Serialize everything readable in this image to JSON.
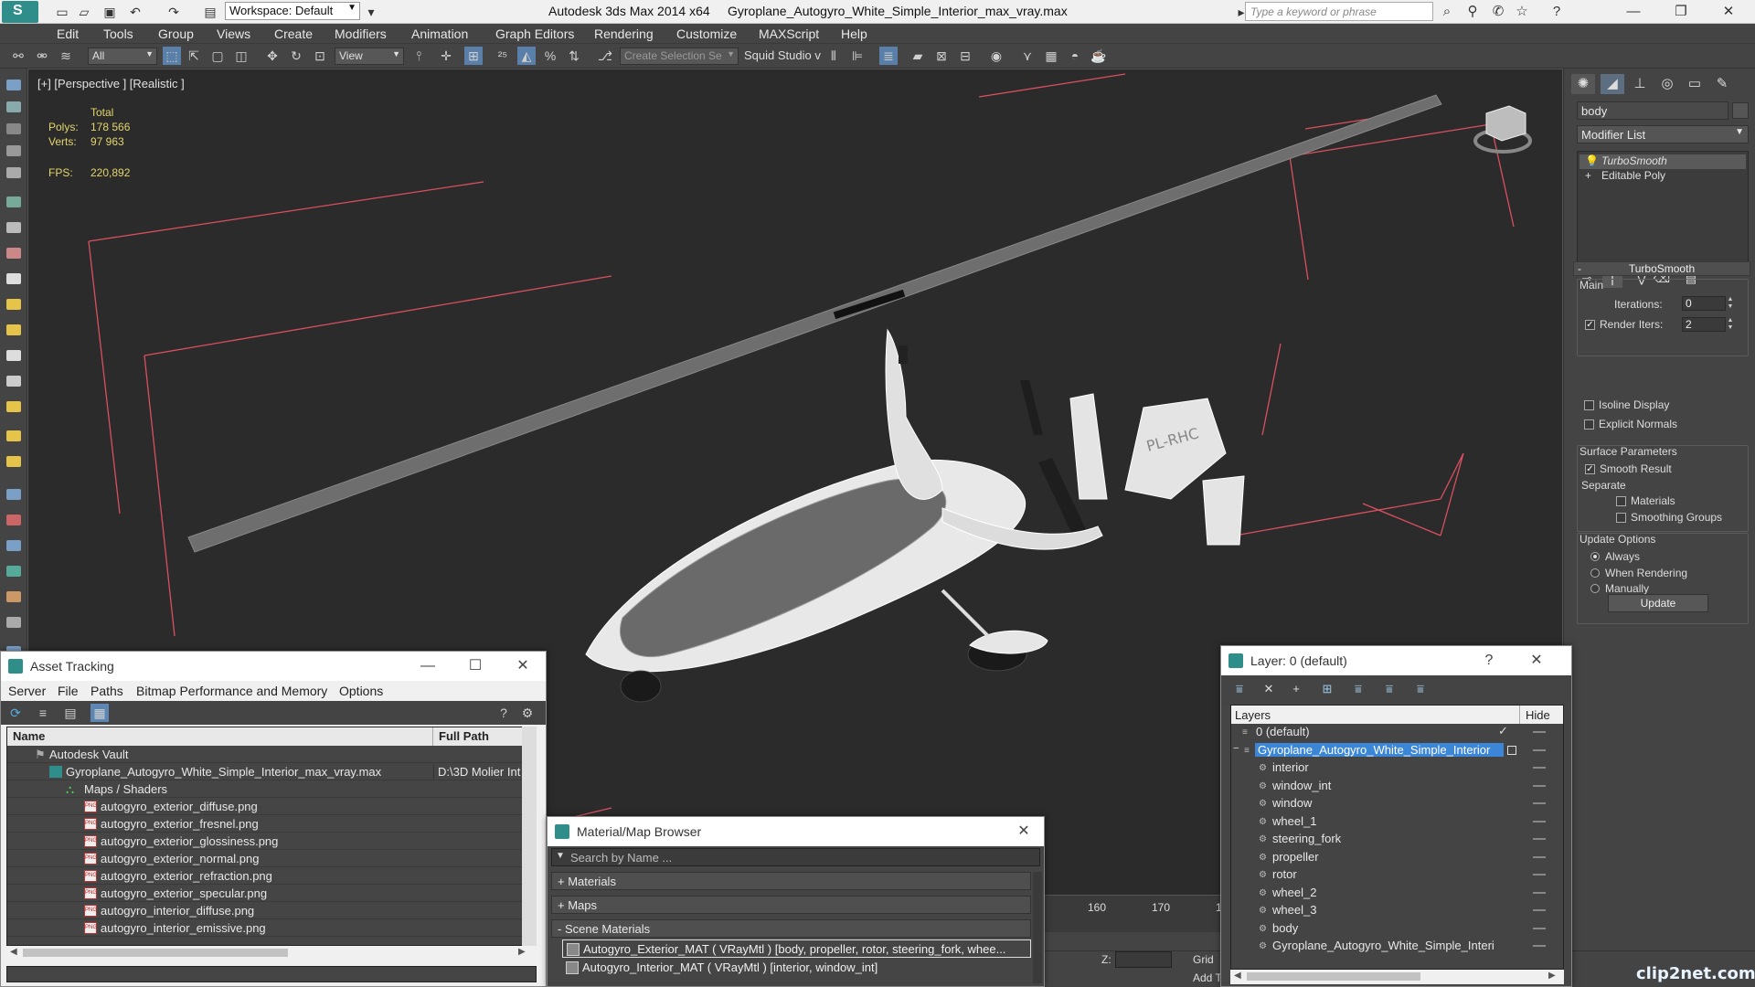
{
  "titlebar": {
    "workspace": "Workspace: Default",
    "app_name": "Autodesk 3ds Max  2014 x64",
    "file_name": "Gyroplane_Autogyro_White_Simple_Interior_max_vray.max",
    "search_placeholder": "Type a keyword or phrase"
  },
  "menu": [
    "Edit",
    "Tools",
    "Group",
    "Views",
    "Create",
    "Modifiers",
    "Animation",
    "Graph Editors",
    "Rendering",
    "Customize",
    "MAXScript",
    "Help"
  ],
  "toolbar": {
    "selection_filter": "All",
    "ref_coord": "View",
    "named_selection_placeholder": "Create Selection Se",
    "squid_label": "Squid Studio v"
  },
  "viewport": {
    "label": "[+] [Perspective ] [Realistic ]",
    "stats_header": "Total",
    "polys_label": "Polys:",
    "polys_value": "178 566",
    "verts_label": "Verts:",
    "verts_value": "97 963",
    "fps_label": "FPS:",
    "fps_value": "220,892",
    "aircraft_reg": "PL-RHC"
  },
  "command_panel": {
    "object_name": "body",
    "modifier_list": "Modifier List",
    "stack": [
      "TurboSmooth",
      "Editable Poly"
    ],
    "rollout_title": "TurboSmooth",
    "main_group": "Main",
    "iterations_label": "Iterations:",
    "iterations_value": "0",
    "render_iters_label": "Render Iters:",
    "render_iters_value": "2",
    "isoline_label": "Isoline Display",
    "explicit_normals_label": "Explicit Normals",
    "surface_params_label": "Surface Parameters",
    "smooth_result_label": "Smooth Result",
    "separate_label": "Separate",
    "materials_label": "Materials",
    "smoothing_groups_label": "Smoothing Groups",
    "update_options_label": "Update Options",
    "always_label": "Always",
    "when_rendering_label": "When Rendering",
    "manually_label": "Manually",
    "update_button": "Update"
  },
  "asset_tracking": {
    "title": "Asset Tracking",
    "menu": [
      "Server",
      "File",
      "Paths",
      "Bitmap Performance and Memory",
      "Options"
    ],
    "col_name": "Name",
    "col_path": "Full Path",
    "vault": "Autodesk Vault",
    "scene_file": "Gyroplane_Autogyro_White_Simple_Interior_max_vray.max",
    "scene_path": "D:\\3D Molier Int",
    "maps_group": "Maps / Shaders",
    "files": [
      "autogyro_exterior_diffuse.png",
      "autogyro_exterior_fresnel.png",
      "autogyro_exterior_glossiness.png",
      "autogyro_exterior_normal.png",
      "autogyro_exterior_refraction.png",
      "autogyro_exterior_specular.png",
      "autogyro_interior_diffuse.png",
      "autogyro_interior_emissive.png"
    ]
  },
  "material_browser": {
    "title": "Material/Map Browser",
    "search_placeholder": "Search by Name ...",
    "sections": [
      "+ Materials",
      "+ Maps",
      "- Scene Materials"
    ],
    "materials": [
      "Autogyro_Exterior_MAT  ( VRayMtl )  [body, propeller, rotor, steering_fork, whee...",
      "Autogyro_Interior_MAT  ( VRayMtl )  [interior, window_int]"
    ]
  },
  "layer_window": {
    "title": "Layer: 0 (default)",
    "col_layers": "Layers",
    "col_hide": "Hide",
    "layers": [
      "0 (default)",
      "Gyroplane_Autogyro_White_Simple_Interior"
    ],
    "objects": [
      "interior",
      "window_int",
      "window",
      "wheel_1",
      "steering_fork",
      "propeller",
      "rotor",
      "wheel_2",
      "wheel_3",
      "body",
      "Gyroplane_Autogyro_White_Simple_Interi"
    ]
  },
  "timeline": {
    "ticks": [
      "160",
      "170",
      "1"
    ],
    "z_label": "Z:",
    "grid_label": "Grid",
    "add_label": "Add T"
  },
  "watermark": "clip2net.com"
}
